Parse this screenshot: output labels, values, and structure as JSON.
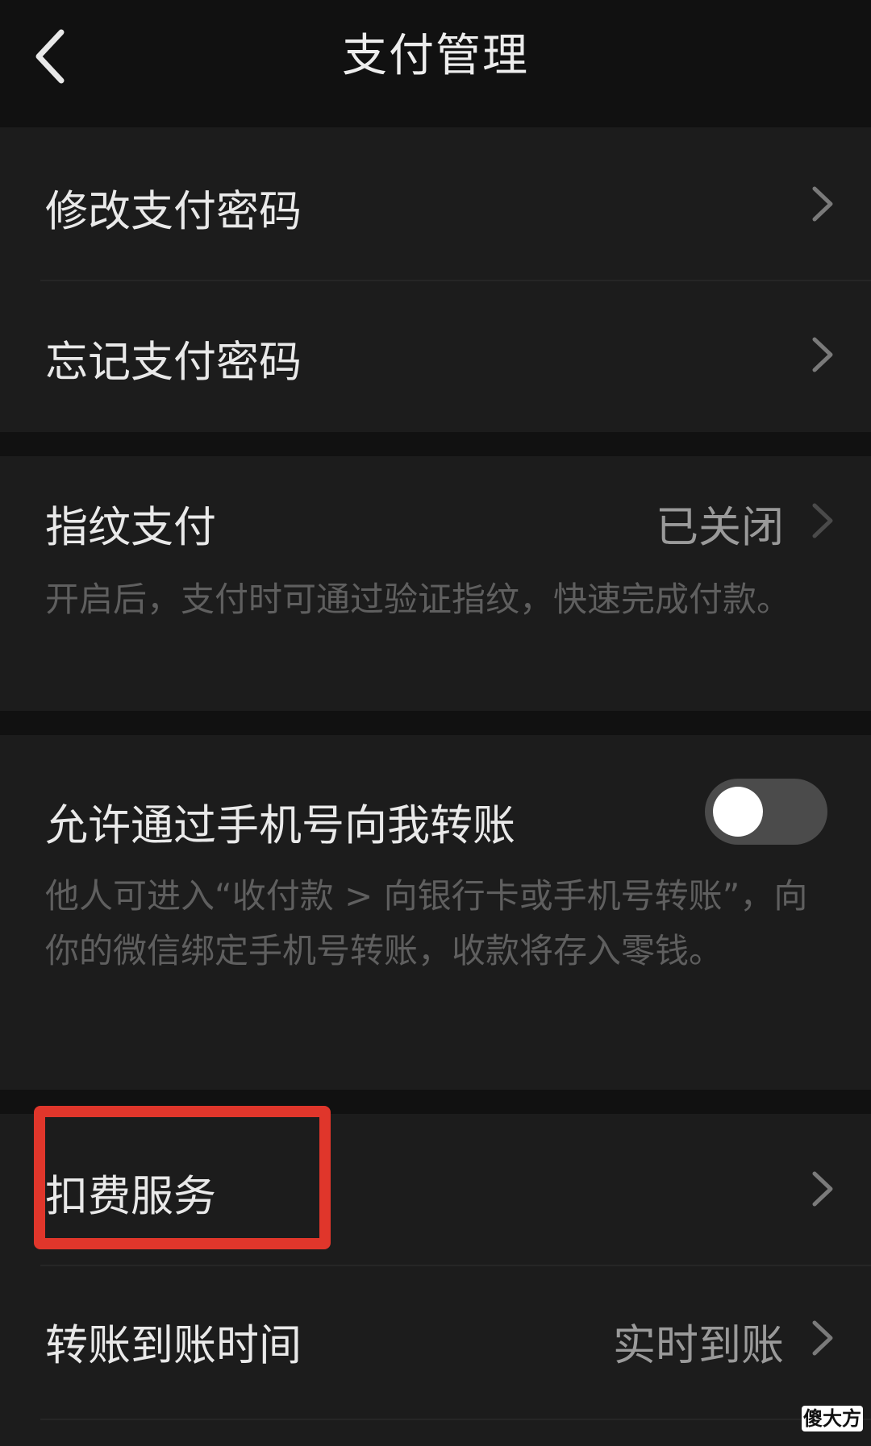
{
  "header": {
    "title": "支付管理",
    "back_icon": "chevron-left-icon"
  },
  "settings": {
    "change_password": {
      "label": "修改支付密码"
    },
    "forgot_password": {
      "label": "忘记支付密码"
    },
    "fingerprint": {
      "label": "指纹支付",
      "value": "已关闭",
      "description": "开启后，支付时可通过验证指纹，快速完成付款。"
    },
    "phone_transfer": {
      "label": "允许通过手机号向我转账",
      "description": "他人可进入“收付款 > 向银行卡或手机号转账”，向你的微信绑定手机号转账，收款将存入零钱。",
      "enabled": false
    },
    "deduction_service": {
      "label": "扣费服务"
    },
    "transfer_time": {
      "label": "转账到账时间",
      "value": "实时到账"
    }
  },
  "watermark": {
    "text": "傻大方"
  },
  "colors": {
    "background": "#111111",
    "row_background": "#1c1c1c",
    "highlight": "#e0362b"
  }
}
